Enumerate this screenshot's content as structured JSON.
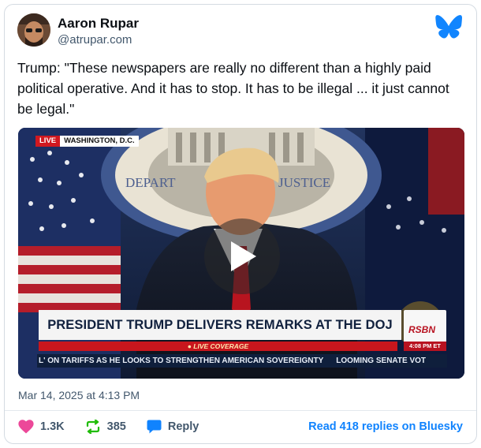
{
  "author": {
    "name": "Aaron Rupar",
    "handle": "@atrupar.com"
  },
  "post": {
    "text": "Trump: \"These newspapers are really no different than a highly paid political operative. And it has to stop. It has to be illegal ... it just cannot be legal.\"",
    "timestamp": "Mar 14, 2025 at 4:13 PM"
  },
  "video": {
    "live_label": "LIVE",
    "location": "WASHINGTON, D.C.",
    "backdrop_text": "DEPARTMENT OF JUSTICE",
    "headline": "PRESIDENT TRUMP DELIVERS REMARKS AT THE DOJ",
    "live_coverage": "● LIVE COVERAGE",
    "network": "RSBN",
    "network_time": "4:08 PM ET",
    "ticker_left": "L' ON TARIFFS AS HE LOOKS TO STRENGTHEN AMERICAN SOVEREIGNTY",
    "ticker_right": "LOOMING SENATE VOT"
  },
  "engagement": {
    "likes": "1.3K",
    "reposts": "385",
    "reply_label": "Reply",
    "read_replies": "Read 418 replies on Bluesky"
  },
  "colors": {
    "like": "#ec4899",
    "repost": "#20bc07",
    "reply": "#1083fe",
    "link": "#1083fe",
    "brand": "#1185fe"
  }
}
